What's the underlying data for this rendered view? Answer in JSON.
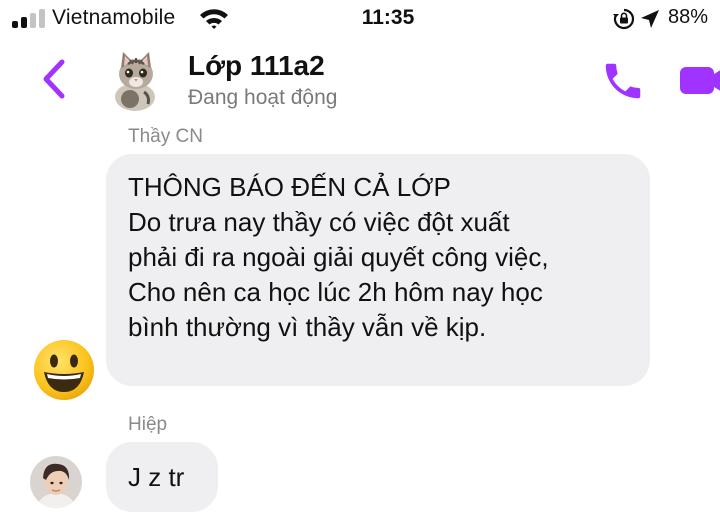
{
  "status_bar": {
    "carrier": "Vietnamobile",
    "time": "11:35",
    "battery": "88%",
    "icons": [
      "signal-icon",
      "wifi-icon",
      "rotation-lock-icon",
      "location-icon"
    ]
  },
  "header": {
    "title": "Lớp 111a2",
    "subtitle": "Đang hoạt động",
    "icons": [
      "back-chevron-icon",
      "cat-avatar",
      "phone-icon",
      "video-call-icon"
    ]
  },
  "messages": [
    {
      "sender": "Thầy CN",
      "avatar": "grinning-face-emoji",
      "lines": [
        "THÔNG BÁO ĐẾN CẢ LỚP",
        "Do trưa nay thầy có việc đột xuất",
        "phải đi ra ngoài giải quyết công việc,",
        "Cho nên ca học lúc 2h hôm nay học",
        "bình thường vì thầy vẫn về kịp."
      ]
    },
    {
      "sender": "Hiệp",
      "avatar": "user-photo-avatar",
      "text": "J z tr"
    }
  ],
  "colors": {
    "accent": "#a033ff",
    "bubble_bg": "#efeff1",
    "subtitle_gray": "#7a7a7a",
    "sender_gray": "#8a8a8a"
  }
}
